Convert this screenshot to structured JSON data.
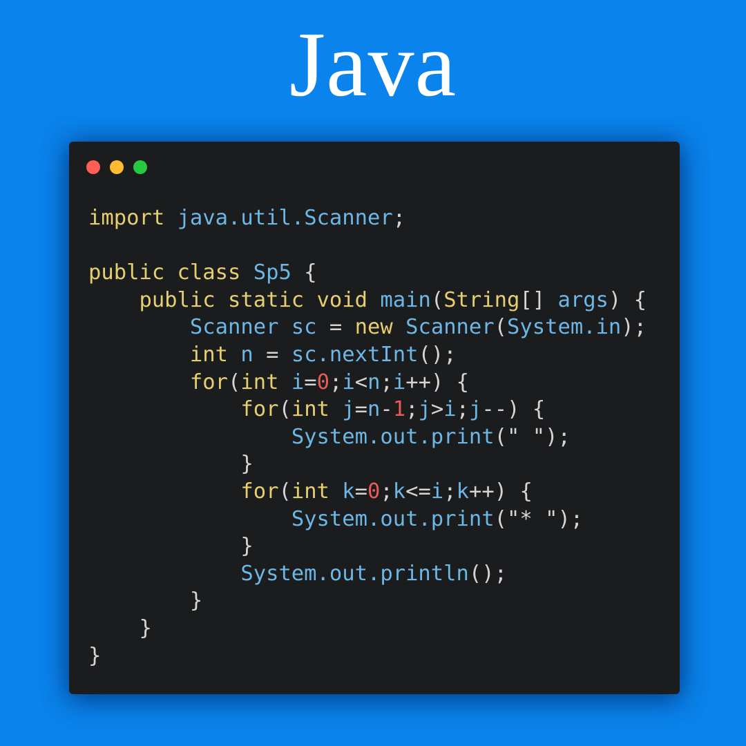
{
  "title": "Java",
  "colors": {
    "background": "#0a84ec",
    "editor_background": "#1b1c1e",
    "keyword": "#e6cf6e",
    "identifier": "#6cb7e6",
    "number": "#ea5a5a",
    "punctuation": "#d5d5d5",
    "dot_red": "#ff5f57",
    "dot_yellow": "#febc2e",
    "dot_green": "#28c840"
  },
  "window_controls": [
    "close-dot",
    "minimize-dot",
    "maximize-dot"
  ],
  "code": {
    "lines": [
      [
        {
          "t": "import",
          "c": "kw"
        },
        {
          "t": " ",
          "c": "pn"
        },
        {
          "t": "java.util.Scanner",
          "c": "ty"
        },
        {
          "t": ";",
          "c": "pn"
        }
      ],
      [],
      [
        {
          "t": "public class",
          "c": "kw"
        },
        {
          "t": " ",
          "c": "pn"
        },
        {
          "t": "Sp5",
          "c": "ty"
        },
        {
          "t": " {",
          "c": "pn"
        }
      ],
      [
        {
          "t": "    ",
          "c": "pn"
        },
        {
          "t": "public static void",
          "c": "kw"
        },
        {
          "t": " ",
          "c": "pn"
        },
        {
          "t": "main",
          "c": "ty"
        },
        {
          "t": "(",
          "c": "pn"
        },
        {
          "t": "String",
          "c": "kw"
        },
        {
          "t": "[] ",
          "c": "pn"
        },
        {
          "t": "args",
          "c": "ty"
        },
        {
          "t": ") {",
          "c": "pn"
        }
      ],
      [
        {
          "t": "        ",
          "c": "pn"
        },
        {
          "t": "Scanner sc",
          "c": "ty"
        },
        {
          "t": " = ",
          "c": "pn"
        },
        {
          "t": "new",
          "c": "kw"
        },
        {
          "t": " ",
          "c": "pn"
        },
        {
          "t": "Scanner",
          "c": "ty"
        },
        {
          "t": "(",
          "c": "pn"
        },
        {
          "t": "System.in",
          "c": "ty"
        },
        {
          "t": ");",
          "c": "pn"
        }
      ],
      [
        {
          "t": "        ",
          "c": "pn"
        },
        {
          "t": "int",
          "c": "kw"
        },
        {
          "t": " ",
          "c": "pn"
        },
        {
          "t": "n",
          "c": "ty"
        },
        {
          "t": " = ",
          "c": "pn"
        },
        {
          "t": "sc.nextInt",
          "c": "ty"
        },
        {
          "t": "();",
          "c": "pn"
        }
      ],
      [
        {
          "t": "        ",
          "c": "pn"
        },
        {
          "t": "for",
          "c": "kw"
        },
        {
          "t": "(",
          "c": "pn"
        },
        {
          "t": "int",
          "c": "kw"
        },
        {
          "t": " ",
          "c": "pn"
        },
        {
          "t": "i",
          "c": "ty"
        },
        {
          "t": "=",
          "c": "pn"
        },
        {
          "t": "0",
          "c": "nm"
        },
        {
          "t": ";",
          "c": "pn"
        },
        {
          "t": "i",
          "c": "ty"
        },
        {
          "t": "<",
          "c": "pn"
        },
        {
          "t": "n",
          "c": "ty"
        },
        {
          "t": ";",
          "c": "pn"
        },
        {
          "t": "i",
          "c": "ty"
        },
        {
          "t": "++) {",
          "c": "pn"
        }
      ],
      [
        {
          "t": "            ",
          "c": "pn"
        },
        {
          "t": "for",
          "c": "kw"
        },
        {
          "t": "(",
          "c": "pn"
        },
        {
          "t": "int",
          "c": "kw"
        },
        {
          "t": " ",
          "c": "pn"
        },
        {
          "t": "j",
          "c": "ty"
        },
        {
          "t": "=",
          "c": "pn"
        },
        {
          "t": "n",
          "c": "ty"
        },
        {
          "t": "-",
          "c": "pn"
        },
        {
          "t": "1",
          "c": "nm"
        },
        {
          "t": ";",
          "c": "pn"
        },
        {
          "t": "j",
          "c": "ty"
        },
        {
          "t": ">",
          "c": "pn"
        },
        {
          "t": "i",
          "c": "ty"
        },
        {
          "t": ";",
          "c": "pn"
        },
        {
          "t": "j",
          "c": "ty"
        },
        {
          "t": "--) {",
          "c": "pn"
        }
      ],
      [
        {
          "t": "                ",
          "c": "pn"
        },
        {
          "t": "System.out.print",
          "c": "ty"
        },
        {
          "t": "(\" \");",
          "c": "pn"
        }
      ],
      [
        {
          "t": "            }",
          "c": "pn"
        }
      ],
      [
        {
          "t": "            ",
          "c": "pn"
        },
        {
          "t": "for",
          "c": "kw"
        },
        {
          "t": "(",
          "c": "pn"
        },
        {
          "t": "int",
          "c": "kw"
        },
        {
          "t": " ",
          "c": "pn"
        },
        {
          "t": "k",
          "c": "ty"
        },
        {
          "t": "=",
          "c": "pn"
        },
        {
          "t": "0",
          "c": "nm"
        },
        {
          "t": ";",
          "c": "pn"
        },
        {
          "t": "k",
          "c": "ty"
        },
        {
          "t": "<=",
          "c": "pn"
        },
        {
          "t": "i",
          "c": "ty"
        },
        {
          "t": ";",
          "c": "pn"
        },
        {
          "t": "k",
          "c": "ty"
        },
        {
          "t": "++) {",
          "c": "pn"
        }
      ],
      [
        {
          "t": "                ",
          "c": "pn"
        },
        {
          "t": "System.out.print",
          "c": "ty"
        },
        {
          "t": "(\"* \");",
          "c": "pn"
        }
      ],
      [
        {
          "t": "            }",
          "c": "pn"
        }
      ],
      [
        {
          "t": "            ",
          "c": "pn"
        },
        {
          "t": "System.out.println",
          "c": "ty"
        },
        {
          "t": "();",
          "c": "pn"
        }
      ],
      [
        {
          "t": "        }",
          "c": "pn"
        }
      ],
      [
        {
          "t": "    }",
          "c": "pn"
        }
      ],
      [
        {
          "t": "}",
          "c": "pn"
        }
      ]
    ]
  }
}
